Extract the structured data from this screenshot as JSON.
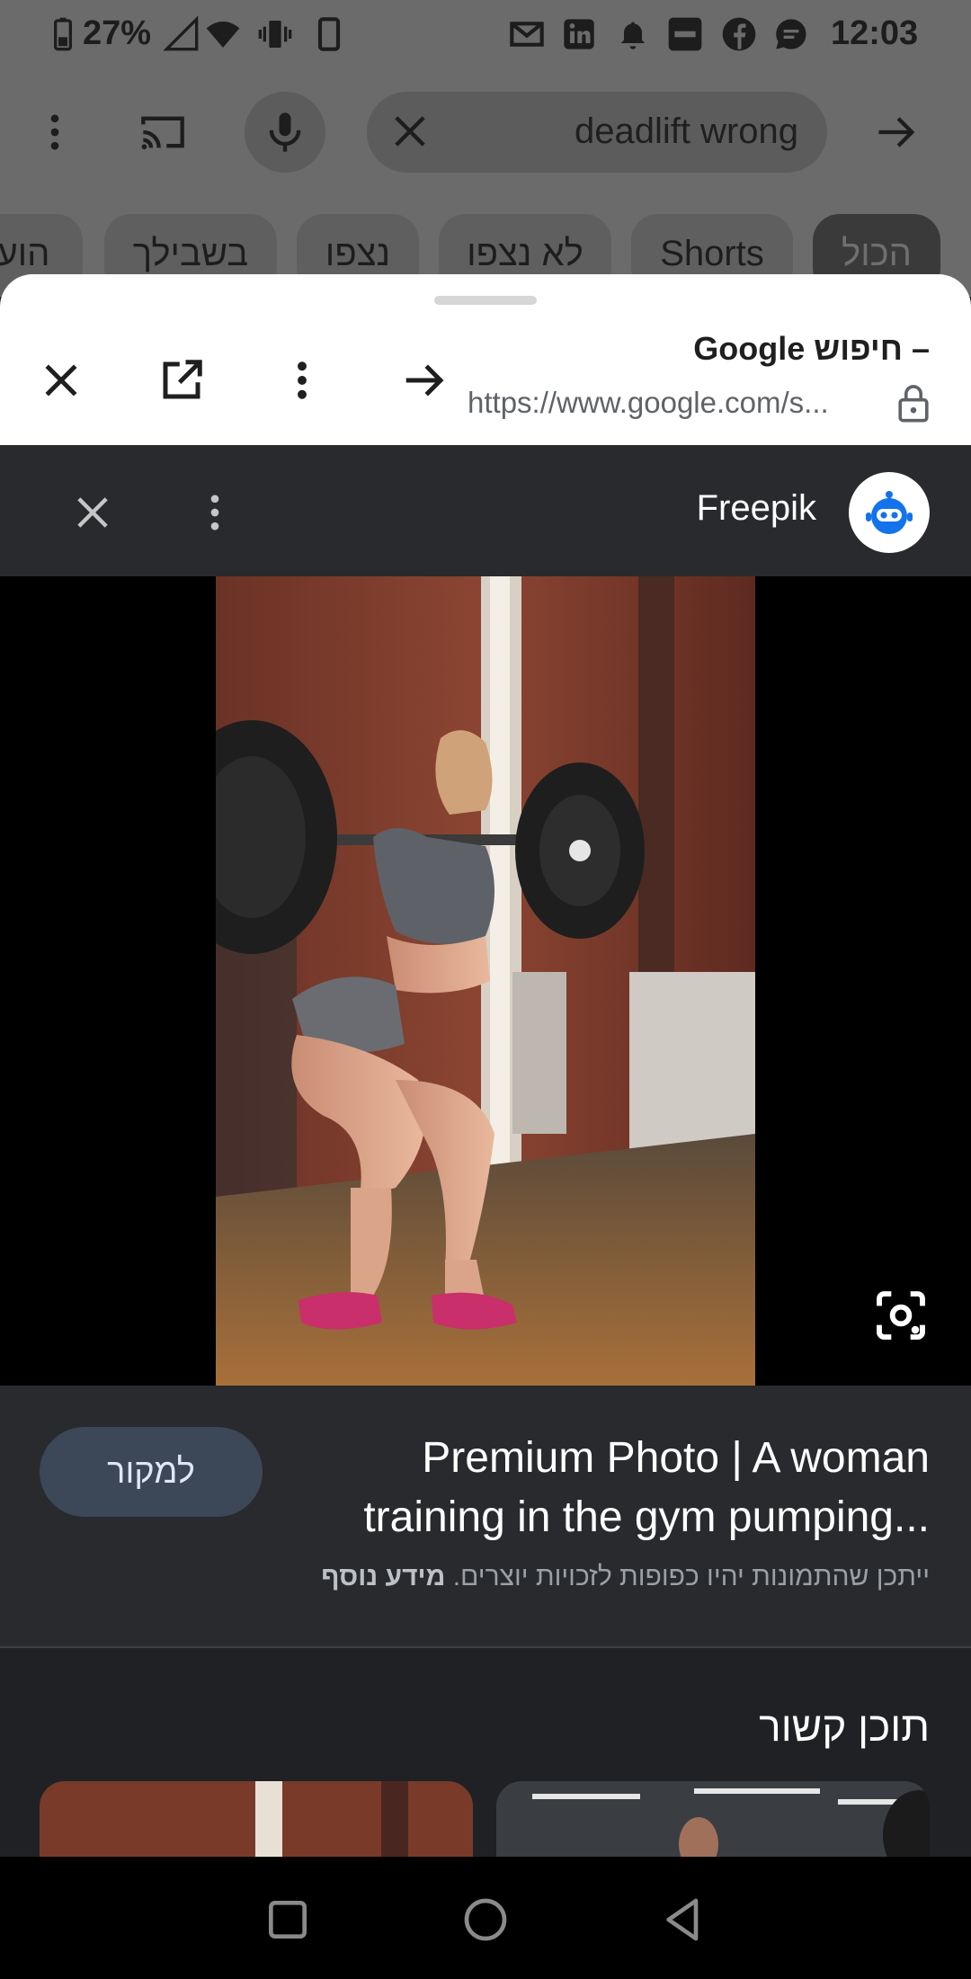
{
  "status_bar": {
    "battery": "27%",
    "time": "12:03",
    "icons": [
      "battery-icon",
      "signal-icon",
      "wifi-icon",
      "vibrate-icon",
      "phone-icon",
      "gmail-icon",
      "linkedin-icon",
      "bell-icon",
      "news-icon",
      "facebook-icon",
      "message-icon"
    ]
  },
  "background_app": {
    "search_query": "deadlift wrong",
    "chips": [
      "הכול",
      "Shorts",
      "לא נצפו",
      "נצפו",
      "בשבילך",
      "הוע"
    ],
    "active_chip": "הכול"
  },
  "custom_tab": {
    "title": "– חיפוש Google",
    "url": "https://www.google.com/s..."
  },
  "image_viewer": {
    "source_name": "Freepik",
    "image_title": "Premium Photo | A woman training in the gym pumping...",
    "visit_button": "למקור",
    "copyright_text": "ייתכן שהתמונות יהיו כפופות לזכויות יוצרים.",
    "more_info_link": "מידע נוסף",
    "related_heading": "תוכן קשור"
  },
  "colors": {
    "accent": "#3c4758",
    "sheet_bg": "#202124",
    "panel_bg": "#292a2d"
  }
}
